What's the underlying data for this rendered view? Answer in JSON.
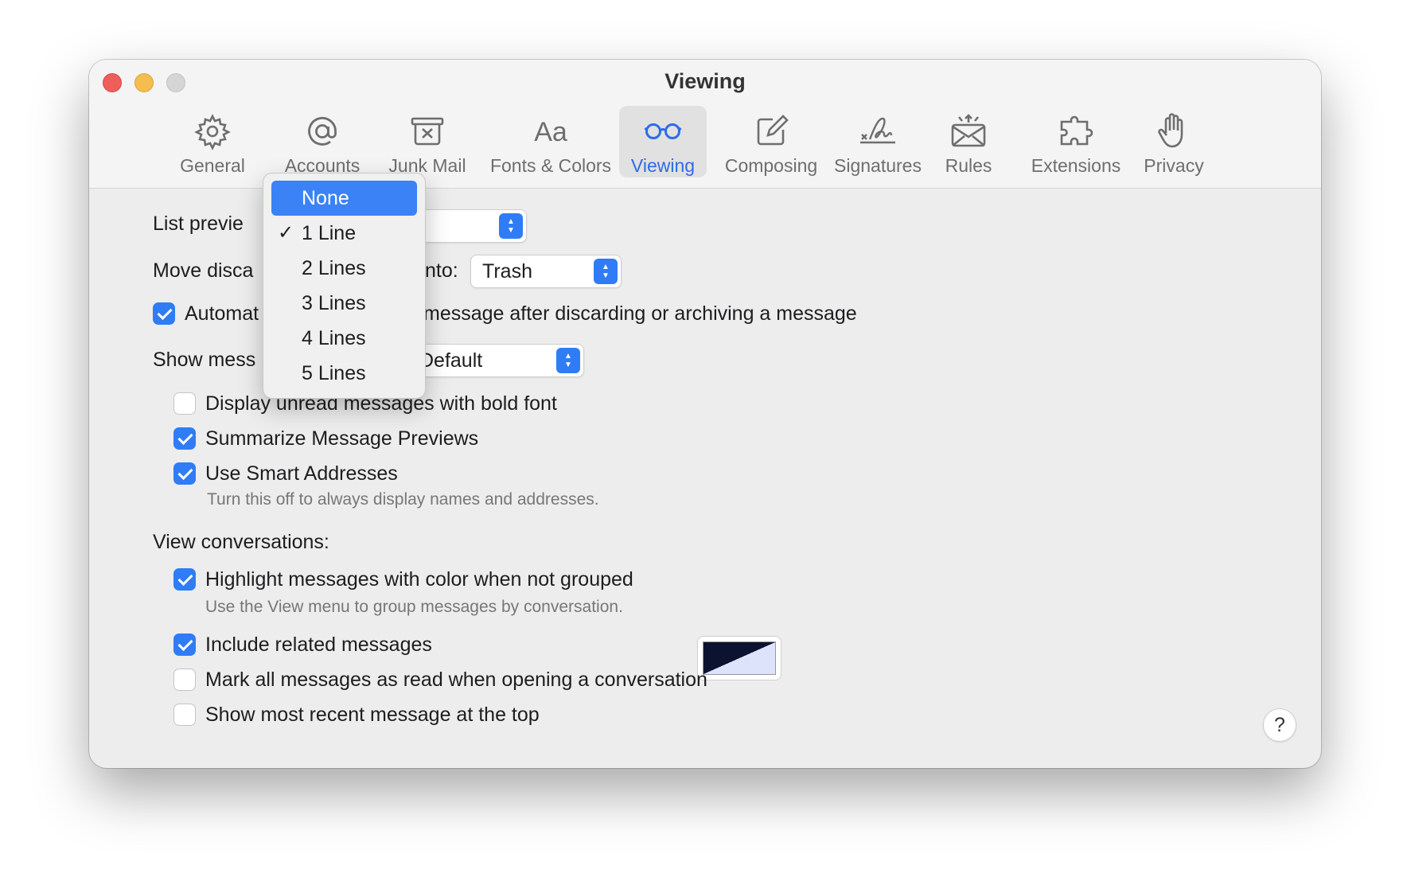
{
  "window": {
    "title": "Viewing"
  },
  "toolbar": {
    "tabs": [
      {
        "label": "General",
        "icon": "gear-icon"
      },
      {
        "label": "Accounts",
        "icon": "at-sign-icon"
      },
      {
        "label": "Junk Mail",
        "icon": "junk-mail-icon"
      },
      {
        "label": "Fonts & Colors",
        "icon": "font-icon"
      },
      {
        "label": "Viewing",
        "icon": "glasses-icon",
        "active": true
      },
      {
        "label": "Composing",
        "icon": "compose-icon"
      },
      {
        "label": "Signatures",
        "icon": "signature-icon"
      },
      {
        "label": "Rules",
        "icon": "rules-icon"
      },
      {
        "label": "Extensions",
        "icon": "puzzle-icon"
      },
      {
        "label": "Privacy",
        "icon": "hand-icon"
      }
    ]
  },
  "settings": {
    "list_preview_label": "List previe",
    "move_label_start": "Move disca",
    "move_label_end": "nto:",
    "move_value": "Trash",
    "auto_label_start": "Automat",
    "auto_label_end": "message after discarding or archiving a message",
    "auto_checked": true,
    "show_label": "Show mess",
    "show_value": "Default",
    "display_unread_bold": {
      "label": "Display unread messages with bold font",
      "checked": false
    },
    "summarize_previews": {
      "label": "Summarize Message Previews",
      "checked": true
    },
    "smart_addresses": {
      "label": "Use Smart Addresses",
      "checked": true,
      "hint": "Turn this off to always display names and addresses."
    },
    "view_conversations_label": "View conversations:",
    "highlight_color": {
      "label": "Highlight messages with color when not grouped",
      "checked": true,
      "hint": "Use the View menu to group messages by conversation."
    },
    "include_related": {
      "label": "Include related messages",
      "checked": true
    },
    "mark_all_read": {
      "label": "Mark all messages as read when opening a conversation",
      "checked": false
    },
    "most_recent_top": {
      "label": "Show most recent message at the top",
      "checked": false
    }
  },
  "list_preview_menu": {
    "items": [
      "None",
      "1 Line",
      "2 Lines",
      "3 Lines",
      "4 Lines",
      "5 Lines"
    ],
    "highlighted": "None",
    "selected": "1 Line"
  },
  "help": {
    "label": "?"
  },
  "colors": {
    "accent": "#2f7cf6",
    "active_tab": "#2e6be6",
    "highlight_swatch_dark": "#0c1330",
    "highlight_swatch_light": "#dce3fb"
  }
}
